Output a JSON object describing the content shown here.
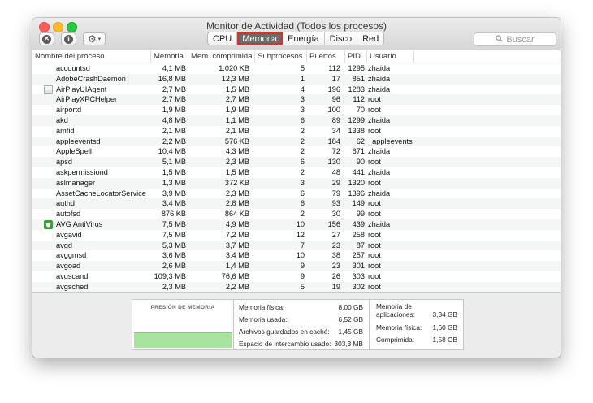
{
  "window": {
    "title": "Monitor de Actividad (Todos los procesos)"
  },
  "toolbar": {
    "close_glyph": "✕",
    "info_glyph": "i",
    "gear_glyph": "⚙",
    "chevron_glyph": "▾",
    "tabs": [
      {
        "label": "CPU",
        "active": false
      },
      {
        "label": "Memoria",
        "active": true
      },
      {
        "label": "Energía",
        "active": false
      },
      {
        "label": "Disco",
        "active": false
      },
      {
        "label": "Red",
        "active": false
      }
    ],
    "search_placeholder": "Buscar"
  },
  "table": {
    "columns": [
      "Nombre del proceso",
      "Memoria",
      "Mem. comprimida",
      "Subprocesos",
      "Puertos",
      "PID",
      "Usuario"
    ],
    "rows": [
      {
        "name": "accountsd",
        "mem": "4,1 MB",
        "comp": "1.020 KB",
        "sub": "5",
        "ports": "112",
        "pid": "1295",
        "user": "zhaida",
        "icon": ""
      },
      {
        "name": "AdobeCrashDaemon",
        "mem": "16,8 MB",
        "comp": "12,3 MB",
        "sub": "1",
        "ports": "17",
        "pid": "851",
        "user": "zhaida",
        "icon": ""
      },
      {
        "name": "AirPlayUIAgent",
        "mem": "2,7 MB",
        "comp": "1,5 MB",
        "sub": "4",
        "ports": "196",
        "pid": "1283",
        "user": "zhaida",
        "icon": "doc"
      },
      {
        "name": "AirPlayXPCHelper",
        "mem": "2,7 MB",
        "comp": "2,7 MB",
        "sub": "3",
        "ports": "96",
        "pid": "112",
        "user": "root",
        "icon": ""
      },
      {
        "name": "airportd",
        "mem": "1,9 MB",
        "comp": "1,9 MB",
        "sub": "3",
        "ports": "100",
        "pid": "70",
        "user": "root",
        "icon": ""
      },
      {
        "name": "akd",
        "mem": "4,8 MB",
        "comp": "1,1 MB",
        "sub": "6",
        "ports": "89",
        "pid": "1299",
        "user": "zhaida",
        "icon": ""
      },
      {
        "name": "amfid",
        "mem": "2,1 MB",
        "comp": "2,1 MB",
        "sub": "2",
        "ports": "34",
        "pid": "1338",
        "user": "root",
        "icon": ""
      },
      {
        "name": "appleeventsd",
        "mem": "2,2 MB",
        "comp": "576 KB",
        "sub": "2",
        "ports": "184",
        "pid": "62",
        "user": "_appleevents",
        "icon": ""
      },
      {
        "name": "AppleSpell",
        "mem": "10,4 MB",
        "comp": "4,3 MB",
        "sub": "2",
        "ports": "72",
        "pid": "671",
        "user": "zhaida",
        "icon": ""
      },
      {
        "name": "apsd",
        "mem": "5,1 MB",
        "comp": "2,3 MB",
        "sub": "6",
        "ports": "130",
        "pid": "90",
        "user": "root",
        "icon": ""
      },
      {
        "name": "askpermissiond",
        "mem": "1,5 MB",
        "comp": "1,5 MB",
        "sub": "2",
        "ports": "48",
        "pid": "441",
        "user": "zhaida",
        "icon": ""
      },
      {
        "name": "aslmanager",
        "mem": "1,3 MB",
        "comp": "372 KB",
        "sub": "3",
        "ports": "29",
        "pid": "1320",
        "user": "root",
        "icon": ""
      },
      {
        "name": "AssetCacheLocatorService",
        "mem": "3,9 MB",
        "comp": "2,3 MB",
        "sub": "6",
        "ports": "79",
        "pid": "1396",
        "user": "zhaida",
        "icon": ""
      },
      {
        "name": "authd",
        "mem": "3,4 MB",
        "comp": "2,8 MB",
        "sub": "6",
        "ports": "93",
        "pid": "149",
        "user": "root",
        "icon": ""
      },
      {
        "name": "autofsd",
        "mem": "876 KB",
        "comp": "864 KB",
        "sub": "2",
        "ports": "30",
        "pid": "99",
        "user": "root",
        "icon": ""
      },
      {
        "name": "AVG AntiVirus",
        "mem": "7,5 MB",
        "comp": "4,9 MB",
        "sub": "10",
        "ports": "156",
        "pid": "439",
        "user": "zhaida",
        "icon": "avg"
      },
      {
        "name": "avgavid",
        "mem": "7,5 MB",
        "comp": "7,2 MB",
        "sub": "12",
        "ports": "27",
        "pid": "258",
        "user": "root",
        "icon": ""
      },
      {
        "name": "avgd",
        "mem": "5,3 MB",
        "comp": "3,7 MB",
        "sub": "7",
        "ports": "23",
        "pid": "87",
        "user": "root",
        "icon": ""
      },
      {
        "name": "avggmsd",
        "mem": "3,6 MB",
        "comp": "3,4 MB",
        "sub": "10",
        "ports": "38",
        "pid": "257",
        "user": "root",
        "icon": ""
      },
      {
        "name": "avgoad",
        "mem": "2,6 MB",
        "comp": "1,4 MB",
        "sub": "9",
        "ports": "23",
        "pid": "301",
        "user": "root",
        "icon": ""
      },
      {
        "name": "avgscand",
        "mem": "109,3 MB",
        "comp": "76,6 MB",
        "sub": "9",
        "ports": "26",
        "pid": "303",
        "user": "root",
        "icon": ""
      },
      {
        "name": "avgsched",
        "mem": "2,3 MB",
        "comp": "2,2 MB",
        "sub": "5",
        "ports": "19",
        "pid": "302",
        "user": "root",
        "icon": ""
      }
    ]
  },
  "memory_panel": {
    "pressure_title": "PRESIÓN DE MEMORIA",
    "pressure_color": "#a7e59f",
    "stats_left": [
      {
        "label": "Memoria física:",
        "value": "8,00 GB"
      },
      {
        "label": "Memoria usada:",
        "value": "6,52 GB"
      },
      {
        "label": "Archivos guardados en caché:",
        "value": "1,45 GB"
      },
      {
        "label": "Espacio de intercambio usado:",
        "value": "303,3 MB"
      }
    ],
    "stats_right": [
      {
        "label1": "Memoria de",
        "label2": "aplicaciones:",
        "value": "3,34 GB"
      },
      {
        "label": "Memoria física:",
        "value": "1,60 GB"
      },
      {
        "label": "Comprimida:",
        "value": "1,58 GB"
      }
    ]
  }
}
